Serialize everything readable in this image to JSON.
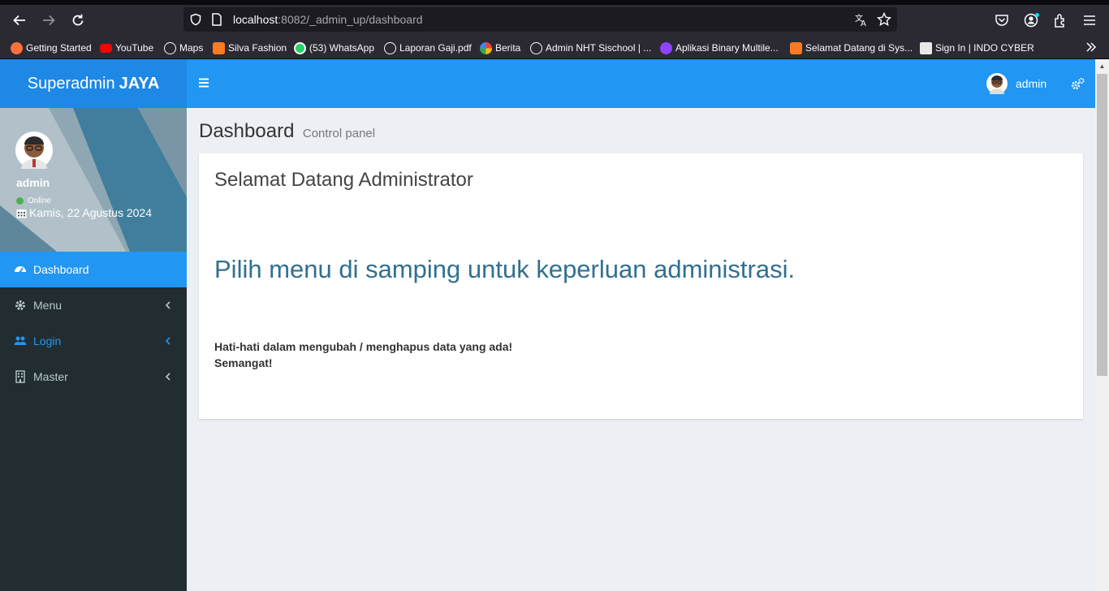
{
  "browser": {
    "url_host": "localhost",
    "url_rest": ":8082/_admin_up/dashboard",
    "bookmarks": [
      {
        "label": "Getting Started",
        "color": "#ff7139"
      },
      {
        "label": "YouTube",
        "color": "#ff0000"
      },
      {
        "label": "Maps",
        "color": "#fbfbfe"
      },
      {
        "label": "Silva Fashion",
        "color": "#fb7a24"
      },
      {
        "label": "(53) WhatsApp",
        "color": "#25d366"
      },
      {
        "label": "Laporan Gaji.pdf",
        "color": "#fbfbfe"
      },
      {
        "label": "Berita",
        "color": "#4285f4"
      },
      {
        "label": "Admin NHT Sischool | ...",
        "color": "#fbfbfe"
      },
      {
        "label": "Aplikasi Binary Multile...",
        "color": "#8e44ff"
      },
      {
        "label": "Selamat Datang di Sys...",
        "color": "#fb7a24"
      },
      {
        "label": "Sign In | INDO CYBER",
        "color": "#e8e8e8"
      }
    ]
  },
  "app": {
    "logo_light": "Superadmin",
    "logo_bold": "JAYA",
    "header_user": "admin",
    "accent": "#2196f3"
  },
  "user_panel": {
    "name": "admin",
    "status": "Online",
    "date": "Kamis, 22 Agustus 2024"
  },
  "sidebar": {
    "items": [
      {
        "label": "Dashboard",
        "icon": "dashboard-icon",
        "active": true
      },
      {
        "label": "Menu",
        "icon": "gear-icon"
      },
      {
        "label": "Login",
        "icon": "users-icon"
      },
      {
        "label": "Master",
        "icon": "building-icon"
      }
    ]
  },
  "content": {
    "title": "Dashboard",
    "subtitle": "Control panel",
    "box_title": "Selamat Datang Administrator",
    "lead": "Pilih menu di samping untuk keperluan administrasi.",
    "warning": "Hati-hati dalam mengubah / menghapus data yang ada!",
    "cheer": "Semangat!"
  }
}
